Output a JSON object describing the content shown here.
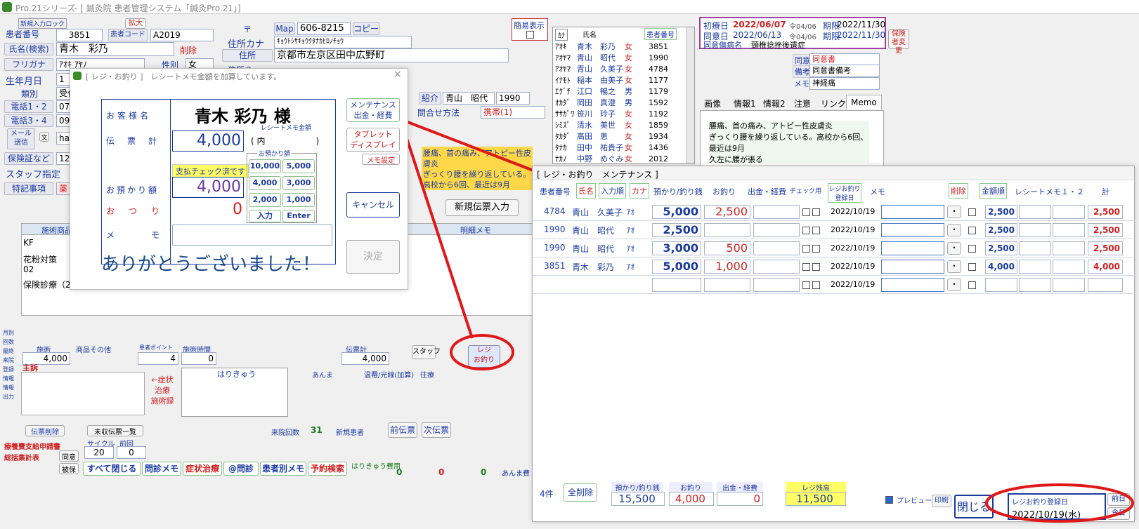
{
  "title": {
    "app": "Pro.21シリーズ",
    "clinic": "- [ 鍼灸院 患者管理システム「鍼灸Pro.21」]"
  },
  "patient": {
    "new_lock": "新規入力ロック",
    "expand": "拡大",
    "id_label": "患者番号",
    "id": "3851",
    "code_label": "患者コード",
    "code": "A2019",
    "name_label": "氏名(検索)",
    "name": "青木　彩乃",
    "delete": "削除",
    "kana_label": "フリガナ",
    "kana": "ｱｵｷ ｱﾔﾉ",
    "sex_label": "性別",
    "sex": "女",
    "birth_label": "生年月日",
    "birth": "1",
    "category_label": "類別",
    "category": "受付",
    "phone12": "電話1・2",
    "phone12_v": "07",
    "phone34": "電話3・4",
    "phone34_v": "09",
    "mail": "メール送信",
    "mail_x": "文",
    "mail_v": "ha",
    "insurance": "保険証など",
    "insurance_v": "12",
    "staff": "スタッフ指定",
    "special": "特記事項",
    "special_v": "薬",
    "postal_mark": "〒",
    "map": "Map",
    "postal": "606-8215",
    "copy": "コピー",
    "addr_kana_label": "住所カナ",
    "addr_kana": "ｷｮｳﾄｼｻｷｮｳｸﾀﾅｶﾋﾛﾉﾁｮｳ",
    "addr_label": "住所",
    "addr": "京都市左京区田中広野町",
    "addr2_label": "住所２",
    "simple": "簡易表示",
    "intro": "紹介",
    "intro_name": "青山　昭代",
    "intro_id": "1990",
    "contact": "問合せ方法",
    "contact_v": "携帯(1)"
  },
  "clinic_info": {
    "first_label": "初療日",
    "first": "2022/06/07",
    "first_r": "令04/06",
    "limit_label": "期限",
    "limit": "2022/11/30",
    "agree_label": "同意日",
    "agree": "2022/06/13",
    "agree_r": "令04/06",
    "limit2": "2022/11/30",
    "disease_label": "同意傷病名",
    "disease": "頸椎捻挫後遺症",
    "ins_change": "保険者変更",
    "consent_label": "同意",
    "consent": "同意書",
    "note_label": "備考",
    "note": "同意書備考",
    "memo_label": "メモ",
    "memo": "神経痛"
  },
  "tabs": [
    "画像",
    "情報1",
    "情報2",
    "注意",
    "リンク",
    "Memo"
  ],
  "memo_text": "腰痛、首の痛み、アトピー性皮膚炎\nぎっくり腰を繰り返している。高校から6回、最近は9月\n久左に腰が張る",
  "yellow_memo": "腰痛、首の痛み、アトピー性皮膚炎\nぎっくり腰を繰り返している。\n高校から6回、最近は9月",
  "patient_list": {
    "kana_h": "ｶﾅ",
    "name_h": "氏名",
    "id_h": "患者番号",
    "rows": [
      [
        "ｱｵｷ",
        "青木　彩乃",
        "女",
        "3851"
      ],
      [
        "ｱｵﾔﾏ",
        "青山　昭代",
        "女",
        "1990"
      ],
      [
        "ｱｵﾔﾏ",
        "青山　久美子",
        "女",
        "4784"
      ],
      [
        "ｲﾅﾓﾄ",
        "稲本　由美子",
        "女",
        "1177"
      ],
      [
        "ｴｸﾞﾁ",
        "江口　暢之",
        "男",
        "1179"
      ],
      [
        "ｵｶﾀﾞ",
        "岡田　真澄",
        "男",
        "1592"
      ],
      [
        "ｻｻｶﾞﾜ",
        "笹川　玲子",
        "女",
        "1192"
      ],
      [
        "ｼﾐｽﾞ",
        "清水　美世",
        "女",
        "1859"
      ],
      [
        "ﾀｶﾀﾞ",
        "高田　恵",
        "女",
        "1934"
      ],
      [
        "ﾀﾅｶ",
        "田中　祐貴子",
        "女",
        "1436"
      ],
      [
        "ﾅｶﾉ",
        "中野　めぐみ",
        "女",
        "2012"
      ]
    ]
  },
  "regi": {
    "title": "[ レジ・お釣り ]　レシートメモ金額を加算しています。",
    "customer_label": "お客様名",
    "customer": "青木 彩乃 様",
    "receipt_memo": "レシートメモ金額",
    "slip_label": "伝票計",
    "slip": "4,000",
    "uchi": "( 内　　　　　　)",
    "paid_check": "支払チェック済です",
    "deposit_label": "お預かり額",
    "deposit": "4,000",
    "change_label": "おつり",
    "change": "0",
    "memo_label": "メモ",
    "deposit_box": "お預かり額",
    "keys": [
      "10,000",
      "5,000",
      "4,000",
      "3,000",
      "2,000",
      "1,000",
      "入力",
      "Enter"
    ],
    "maint": "メンテナンス\n出金・経費",
    "tablet": "タブレット\nディスプレイ",
    "memo_set": "メモ設定",
    "cancel": "キャンセル",
    "ok": "決定",
    "thanks": "ありがとうございました！"
  },
  "maint": {
    "title": "[ レジ・お釣り　メンテナンス ]",
    "headers": {
      "id": "患者番号",
      "name": "氏名",
      "order": "入力順",
      "kana": "カナ",
      "deposit": "預かり/釣り銭",
      "change": "お釣り",
      "expense": "出金・経費",
      "check": "チェック用",
      "date": "レジお釣り登録日",
      "memo": "メモ",
      "delete": "削除",
      "amount_order": "金額順",
      "receipt": "レシートメモ１・２",
      "total": "計"
    },
    "rows": [
      {
        "id": "4784",
        "name": "青山　久美子",
        "kana": "ｱｵ",
        "deposit": "5,000",
        "change": "2,500",
        "date": "2022/10/19",
        "r1": "2,500",
        "total": "2,500"
      },
      {
        "id": "1990",
        "name": "青山　昭代",
        "kana": "ｱｵ",
        "deposit": "2,500",
        "change": "",
        "date": "2022/10/19",
        "r1": "2,500",
        "total": "2,500"
      },
      {
        "id": "1990",
        "name": "青山　昭代",
        "kana": "ｱｵ",
        "deposit": "3,000",
        "change": "500",
        "date": "2022/10/19",
        "r1": "2,500",
        "total": "2,500"
      },
      {
        "id": "3851",
        "name": "青木　彩乃",
        "kana": "ｱｵ",
        "deposit": "5,000",
        "change": "1,000",
        "date": "2022/10/19",
        "r1": "4,000",
        "total": "4,000"
      },
      {
        "id": "",
        "name": "",
        "kana": "",
        "deposit": "",
        "change": "",
        "date": "2022/10/19",
        "r1": "",
        "total": ""
      }
    ],
    "count": "4件",
    "clear_all": "全削除",
    "sum_deposit_label": "預かり/釣り銭",
    "sum_deposit": "15,500",
    "sum_change_label": "お釣り",
    "sum_change": "4,000",
    "sum_expense_label": "出金・経費",
    "sum_expense": "0",
    "balance_label": "レジ残高",
    "balance": "11,500",
    "preview": "プレビュー",
    "print": "印刷",
    "close": "閉じる",
    "reg_date_label": "レジお釣り登録日",
    "reg_date": "2022/10/19(水)",
    "prev_day": "前日",
    "today": "今日"
  },
  "bottom": {
    "treat_label": "施術",
    "treat": "4,000",
    "goods_label": "商品その他",
    "point_label": "患者ポイント",
    "point": "4",
    "time_label": "施術時間",
    "time": "0",
    "slip_label": "伝票計",
    "slip": "4,000",
    "regi": "レジ\nお釣り",
    "main_complaint": "主訴",
    "symptom": "←症状\n治療\n施術録",
    "hari": "はりきゅう",
    "anma": "あんま",
    "onshippu": "温罨/光線(加算)",
    "oshin": "往療",
    "slip_delete": "伝票削除",
    "unpaid": "未収伝票一覧",
    "prev_slip": "前伝票",
    "next_slip": "次伝票",
    "visits_label": "来院回数",
    "visits": "31",
    "new_patient": "新規患者",
    "cost_req": "療養費支給申請書",
    "total_calc": "総括集計表",
    "agree": "同意",
    "insured": "被保",
    "close_all": "すべて閉じる",
    "ask_memo": "問診メモ",
    "symptom_treat": "症状治療",
    "ask": "@問診",
    "patient_memo": "患者別メモ",
    "reserve": "予約検索",
    "hari_cost": "はりきゅう費用",
    "hari_v": "0",
    "self_v": "0",
    "ins_v": "0",
    "anma_cost": "あんま費",
    "cycle_label": "サイクル",
    "cycle": "20",
    "prev_label": "前回",
    "prev": "0"
  },
  "colors": {
    "accent_blue": "#1a3aa0",
    "red": "#d02020",
    "annotation": "#e01818",
    "yellow": "#ffff66"
  }
}
